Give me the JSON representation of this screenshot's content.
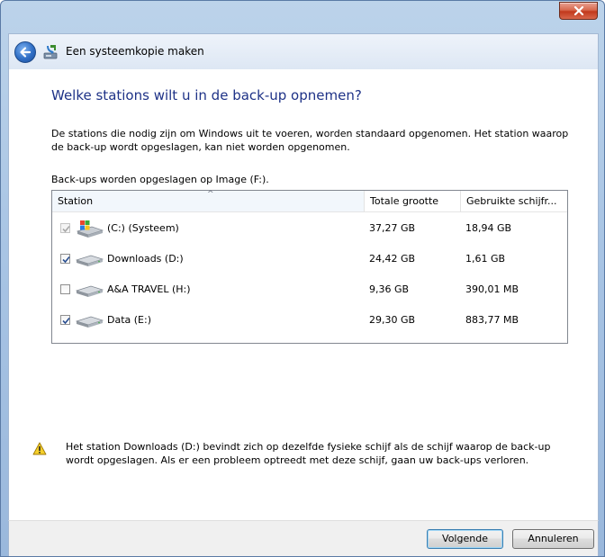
{
  "window": {
    "close_glyph": "✕"
  },
  "header": {
    "title": "Een systeemkopie maken",
    "back_icon": "back-arrow-icon",
    "app_icon": "backup-icon"
  },
  "main": {
    "heading": "Welke stations wilt u in de back-up opnemen?",
    "description": "De stations die nodig zijn om Windows uit te voeren, worden standaard opgenomen. Het station waarop de back-up wordt opgeslagen, kan niet worden opgenomen.",
    "destination": "Back-ups worden opgeslagen op Image (F:).",
    "table": {
      "columns": [
        "Station",
        "Totale grootte",
        "Gebruikte schijfr..."
      ],
      "sort_indicator": "^",
      "rows": [
        {
          "name": "(C:) (Systeem)",
          "size": "37,27 GB",
          "used": "18,94 GB",
          "checked": true,
          "disabled": true,
          "icon": "system-drive-icon"
        },
        {
          "name": "Downloads (D:)",
          "size": "24,42 GB",
          "used": "1,61 GB",
          "checked": true,
          "disabled": false,
          "icon": "hard-drive-icon"
        },
        {
          "name": "A&A TRAVEL (H:)",
          "size": "9,36 GB",
          "used": "390,01 MB",
          "checked": false,
          "disabled": false,
          "icon": "hard-drive-icon"
        },
        {
          "name": "Data (E:)",
          "size": "29,30 GB",
          "used": "883,77 MB",
          "checked": true,
          "disabled": false,
          "icon": "hard-drive-icon"
        }
      ]
    },
    "warning": "Het station Downloads (D:) bevindt zich op dezelfde fysieke schijf als de schijf waarop de back-up wordt opgeslagen. Als er een probleem optreedt met deze schijf, gaan uw back-ups verloren."
  },
  "footer": {
    "next_label": "Volgende",
    "cancel_label": "Annuleren"
  }
}
